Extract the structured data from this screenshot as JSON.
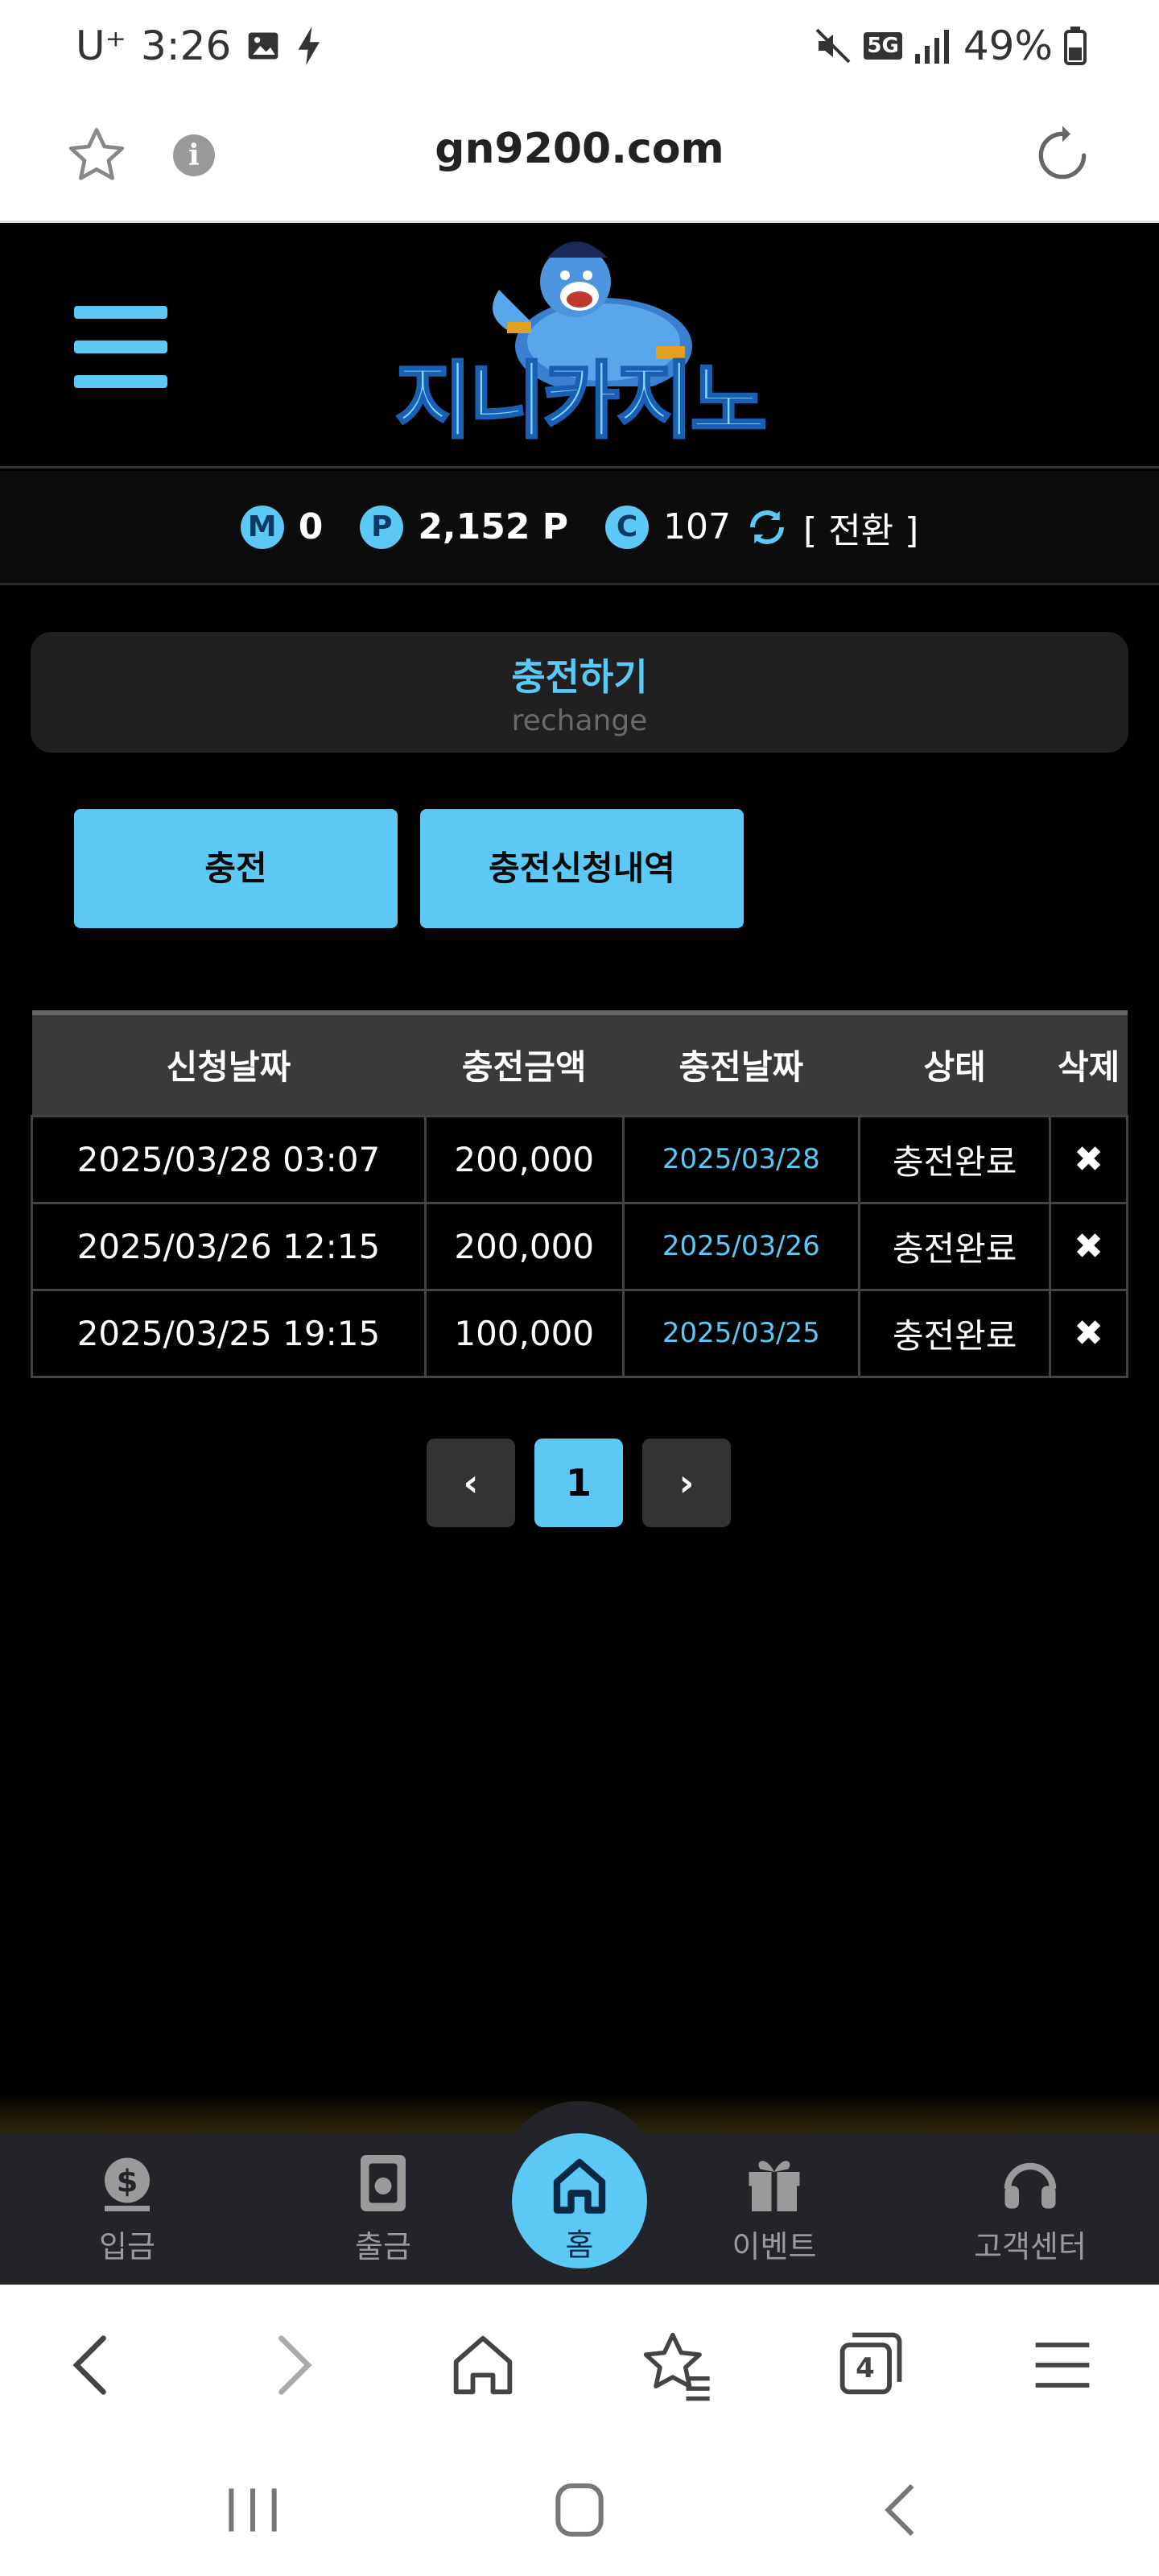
{
  "status_bar": {
    "carrier": "U⁺",
    "time": "3:26",
    "battery": "49%",
    "network": "5G"
  },
  "browser": {
    "url": "gn9200.com",
    "tab_count": "4"
  },
  "header": {
    "logo_text": "지니카지노"
  },
  "balance": {
    "m_label": "M",
    "m_value": "0",
    "p_label": "P",
    "p_value": "2,152 P",
    "c_label": "C",
    "c_value": "107",
    "switch_label": "[ 전환 ]"
  },
  "page": {
    "title": "충전하기",
    "subtitle": "rechange"
  },
  "buttons": {
    "charge": "충전",
    "history": "충전신청내역"
  },
  "table": {
    "headers": [
      "신청날짜",
      "충전금액",
      "충전날짜",
      "상태",
      "삭제"
    ],
    "rows": [
      {
        "request_date": "2025/03/28 03:07",
        "amount": "200,000",
        "charge_date": "2025/03/28",
        "status": "충전완료",
        "delete": "✖"
      },
      {
        "request_date": "2025/03/26 12:15",
        "amount": "200,000",
        "charge_date": "2025/03/26",
        "status": "충전완료",
        "delete": "✖"
      },
      {
        "request_date": "2025/03/25 19:15",
        "amount": "100,000",
        "charge_date": "2025/03/25",
        "status": "충전완료",
        "delete": "✖"
      }
    ]
  },
  "pagination": {
    "prev": "‹",
    "current": "1",
    "next": "›"
  },
  "bottom_nav": {
    "deposit": "입금",
    "withdraw": "출금",
    "home": "홈",
    "event": "이벤트",
    "support": "고객센터"
  },
  "colors": {
    "accent": "#5cc8f5",
    "background": "#000000",
    "panel": "#211f1f",
    "nav": "#22242a"
  },
  "icons": {
    "menu": "hamburger-icon",
    "refresh": "refresh-icon",
    "deposit": "money-bag-icon",
    "withdraw": "safe-icon",
    "home": "home-icon",
    "event": "gift-icon",
    "support": "headset-icon"
  }
}
